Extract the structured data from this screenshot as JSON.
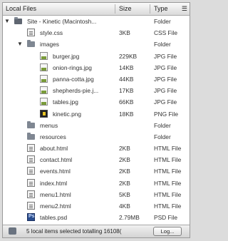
{
  "header": {
    "col_name": "Local Files",
    "col_size": "Size",
    "col_type": "Type",
    "options_glyph": "☰"
  },
  "rows": [
    {
      "name": "Site - Kinetic (Macintosh...",
      "size": "",
      "type": "Folder",
      "icon": "site-folder-icon",
      "expanded": true
    },
    {
      "name": "style.css",
      "size": "3KB",
      "type": "CSS File",
      "icon": "css-file-icon"
    },
    {
      "name": "images",
      "size": "",
      "type": "Folder",
      "icon": "folder-icon",
      "expanded": true
    },
    {
      "name": "burger.jpg",
      "size": "229KB",
      "type": "JPG File",
      "icon": "image-file-icon"
    },
    {
      "name": "onion-rings.jpg",
      "size": "14KB",
      "type": "JPG File",
      "icon": "image-file-icon"
    },
    {
      "name": "panna-cotta.jpg",
      "size": "44KB",
      "type": "JPG File",
      "icon": "image-file-icon"
    },
    {
      "name": "shepherds-pie.j...",
      "size": "17KB",
      "type": "JPG File",
      "icon": "image-file-icon"
    },
    {
      "name": "tables.jpg",
      "size": "66KB",
      "type": "JPG File",
      "icon": "image-file-icon"
    },
    {
      "name": "kinetic.png",
      "size": "18KB",
      "type": "PNG File",
      "icon": "png-file-icon"
    },
    {
      "name": "menus",
      "size": "",
      "type": "Folder",
      "icon": "folder-icon"
    },
    {
      "name": "resources",
      "size": "",
      "type": "Folder",
      "icon": "folder-icon"
    },
    {
      "name": "about.html",
      "size": "2KB",
      "type": "HTML File",
      "icon": "html-file-icon"
    },
    {
      "name": "contact.html",
      "size": "2KB",
      "type": "HTML File",
      "icon": "html-file-icon"
    },
    {
      "name": "events.html",
      "size": "2KB",
      "type": "HTML File",
      "icon": "html-file-icon"
    },
    {
      "name": "index.html",
      "size": "2KB",
      "type": "HTML File",
      "icon": "html-file-icon"
    },
    {
      "name": "menu1.html",
      "size": "5KB",
      "type": "HTML File",
      "icon": "html-file-icon"
    },
    {
      "name": "menu2.html",
      "size": "4KB",
      "type": "HTML File",
      "icon": "html-file-icon"
    },
    {
      "name": "tables.psd",
      "size": "2.79MB",
      "type": "PSD File",
      "icon": "psd-file-icon"
    }
  ],
  "status": {
    "text": "5 local items selected totalling 16108(",
    "log_button": "Log..."
  }
}
